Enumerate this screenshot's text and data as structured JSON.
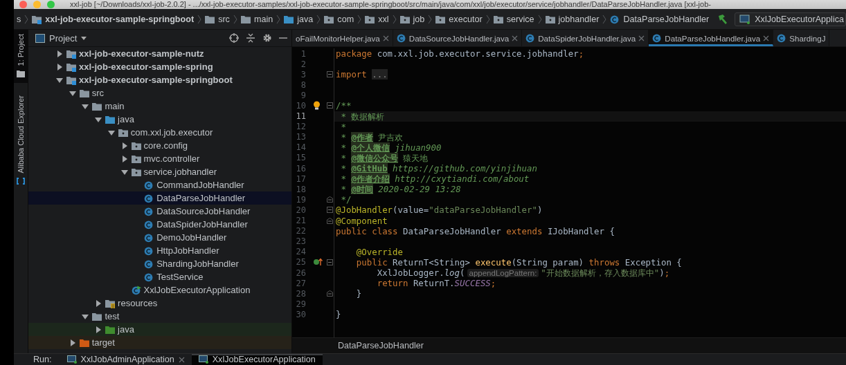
{
  "window": {
    "title": "xxl-job [~/Downloads/xxl-job-2.0.2] - .../xxl-job-executor-samples/xxl-job-executor-sample-springboot/src/main/java/com/xxl/job/executor/service/jobhandler/DataParseJobHandler.java [xxl-job-"
  },
  "navigation_bar": {
    "items": [
      {
        "label": "s",
        "kind": "plain"
      },
      {
        "label": "xxl-job-executor-sample-springboot",
        "kind": "module"
      },
      {
        "label": "src",
        "kind": "folder"
      },
      {
        "label": "main",
        "kind": "folder"
      },
      {
        "label": "java",
        "kind": "source"
      },
      {
        "label": "com",
        "kind": "package"
      },
      {
        "label": "xxl",
        "kind": "package"
      },
      {
        "label": "job",
        "kind": "package"
      },
      {
        "label": "executor",
        "kind": "package"
      },
      {
        "label": "service",
        "kind": "package"
      },
      {
        "label": "jobhandler",
        "kind": "package"
      },
      {
        "label": "DataParseJobHandler",
        "kind": "class"
      }
    ],
    "run_config": "XxlJobExecutorApplica"
  },
  "tool_stripe": [
    {
      "label": "1: Project",
      "selected": true
    },
    {
      "label": "Alibaba Cloud Explorer",
      "selected": false
    }
  ],
  "project_panel": {
    "title": "Project",
    "tree": [
      {
        "label": "xxl-job-executor-sample-nutz",
        "kind": "module",
        "expanded": false,
        "selected": false
      },
      {
        "label": "xxl-job-executor-sample-spring",
        "kind": "module",
        "expanded": false,
        "selected": false
      },
      {
        "label": "xxl-job-executor-sample-springboot",
        "kind": "module",
        "expanded": true,
        "selected": false,
        "children": [
          {
            "label": "src",
            "kind": "folder",
            "expanded": true,
            "selected": false,
            "children": [
              {
                "label": "main",
                "kind": "folder",
                "expanded": true,
                "selected": false,
                "children": [
                  {
                    "label": "java",
                    "kind": "source",
                    "expanded": true,
                    "selected": false,
                    "children": [
                      {
                        "label": "com.xxl.job.executor",
                        "kind": "package",
                        "expanded": true,
                        "selected": false,
                        "children": [
                          {
                            "label": "core.config",
                            "kind": "package",
                            "expanded": false,
                            "selected": false
                          },
                          {
                            "label": "mvc.controller",
                            "kind": "package",
                            "expanded": false,
                            "selected": false
                          },
                          {
                            "label": "service.jobhandler",
                            "kind": "package",
                            "expanded": true,
                            "selected": false,
                            "children": [
                              {
                                "label": "CommandJobHandler",
                                "kind": "class",
                                "selected": false
                              },
                              {
                                "label": "DataParseJobHandler",
                                "kind": "class",
                                "selected": true
                              },
                              {
                                "label": "DataSourceJobHandler",
                                "kind": "class",
                                "selected": false
                              },
                              {
                                "label": "DataSpiderJobHandler",
                                "kind": "class",
                                "selected": false
                              },
                              {
                                "label": "DemoJobHandler",
                                "kind": "class",
                                "selected": false
                              },
                              {
                                "label": "HttpJobHandler",
                                "kind": "class",
                                "selected": false
                              },
                              {
                                "label": "ShardingJobHandler",
                                "kind": "class",
                                "selected": false
                              },
                              {
                                "label": "TestService",
                                "kind": "class",
                                "selected": false
                              }
                            ]
                          },
                          {
                            "label": "XxlJobExecutorApplication",
                            "kind": "application",
                            "selected": false
                          }
                        ]
                      }
                    ]
                  },
                  {
                    "label": "resources",
                    "kind": "resources",
                    "expanded": false,
                    "selected": false
                  }
                ]
              },
              {
                "label": "test",
                "kind": "folder",
                "expanded": true,
                "selected": false,
                "children": [
                  {
                    "label": "java",
                    "kind": "test",
                    "expanded": false,
                    "selected": false
                  }
                ]
              }
            ]
          },
          {
            "label": "target",
            "kind": "excluded",
            "expanded": false,
            "selected": false
          }
        ]
      }
    ]
  },
  "editor": {
    "tabs": [
      {
        "label": "oFailMonitorHelper.java",
        "kind": "plain",
        "selected": false
      },
      {
        "label": "DataSourceJobHandler.java",
        "kind": "class",
        "selected": false
      },
      {
        "label": "DataSpiderJobHandler.java",
        "kind": "class",
        "selected": false
      },
      {
        "label": "DataParseJobHandler.java",
        "kind": "class",
        "selected": true
      },
      {
        "label": "ShardingJ",
        "kind": "class",
        "selected": false
      }
    ],
    "lines": [
      {
        "number": "1",
        "current": false,
        "kind": "plain",
        "tokens": [
          {
            "kind": "keyword",
            "t": "package "
          },
          {
            "kind": "plain",
            "t": "com.xxl.job.executor.service.jobhandler"
          },
          {
            "kind": "keyword",
            "t": ";"
          }
        ]
      },
      {
        "number": "2",
        "current": false,
        "kind": "plain"
      },
      {
        "number": "3",
        "current": false,
        "kind": "fold",
        "tokens": [
          {
            "kind": "keyword",
            "t": "import "
          },
          {
            "kind": "folded",
            "t": "..."
          }
        ]
      },
      {
        "number": "8",
        "current": false,
        "kind": "plain"
      },
      {
        "number": "9",
        "current": false,
        "kind": "plain"
      },
      {
        "number": "10",
        "current": false,
        "kind": "hint",
        "tokens": [
          {
            "kind": "doc",
            "t": "/**"
          }
        ]
      },
      {
        "number": "11",
        "current": true,
        "kind": "plain",
        "tokens": [
          {
            "kind": "doc",
            "t": " * 数据解析"
          }
        ]
      },
      {
        "number": "12",
        "current": false,
        "kind": "plain",
        "tokens": [
          {
            "kind": "doc",
            "t": " *"
          }
        ]
      },
      {
        "number": "13",
        "current": false,
        "kind": "plain",
        "tokens": [
          {
            "kind": "doc",
            "t": " * "
          },
          {
            "kind": "doctag",
            "t": "@作者"
          },
          {
            "kind": "doc",
            "t": " 尹吉欢"
          }
        ]
      },
      {
        "number": "14",
        "current": false,
        "kind": "plain",
        "tokens": [
          {
            "kind": "doc",
            "t": " * "
          },
          {
            "kind": "doctag",
            "t": "@个人微信"
          },
          {
            "kind": "docvalue",
            "t": " jihuan900"
          }
        ]
      },
      {
        "number": "15",
        "current": false,
        "kind": "plain",
        "tokens": [
          {
            "kind": "doc",
            "t": " * "
          },
          {
            "kind": "doctag",
            "t": "@微信公众号"
          },
          {
            "kind": "doc",
            "t": " 猿天地"
          }
        ]
      },
      {
        "number": "16",
        "current": false,
        "kind": "plain",
        "tokens": [
          {
            "kind": "doc",
            "t": " * "
          },
          {
            "kind": "doctag",
            "t": "@GitHub"
          },
          {
            "kind": "docvalue",
            "t": " https://github.com/yinjihuan"
          }
        ]
      },
      {
        "number": "17",
        "current": false,
        "kind": "plain",
        "tokens": [
          {
            "kind": "doc",
            "t": " * "
          },
          {
            "kind": "doctag",
            "t": "@作者介绍"
          },
          {
            "kind": "docvalue",
            "t": " http://cxytiandi.com/about"
          }
        ]
      },
      {
        "number": "18",
        "current": false,
        "kind": "plain",
        "tokens": [
          {
            "kind": "doc",
            "t": " * "
          },
          {
            "kind": "doctag",
            "t": "@时间"
          },
          {
            "kind": "docvalue",
            "t": " 2020-02-29 13:28"
          }
        ]
      },
      {
        "number": "19",
        "current": false,
        "kind": "foldend",
        "tokens": [
          {
            "kind": "doc",
            "t": " */"
          }
        ]
      },
      {
        "number": "20",
        "current": false,
        "kind": "fold",
        "tokens": [
          {
            "kind": "annotation",
            "t": "@JobHandler"
          },
          {
            "kind": "plain",
            "t": "(value="
          },
          {
            "kind": "string",
            "t": "\"dataParseJobHandler\""
          },
          {
            "kind": "plain",
            "t": ")"
          }
        ]
      },
      {
        "number": "21",
        "current": false,
        "kind": "foldend",
        "tokens": [
          {
            "kind": "annotation",
            "t": "@Component"
          }
        ]
      },
      {
        "number": "22",
        "current": false,
        "kind": "plain",
        "tokens": [
          {
            "kind": "keyword",
            "t": "public class "
          },
          {
            "kind": "plain",
            "t": "DataParseJobHandler "
          },
          {
            "kind": "keyword",
            "t": "extends "
          },
          {
            "kind": "plain",
            "t": "IJobHandler {"
          }
        ]
      },
      {
        "number": "23",
        "current": false,
        "kind": "plain"
      },
      {
        "number": "24",
        "current": false,
        "kind": "plain",
        "tokens": [
          {
            "kind": "annotation",
            "t": "    @Override"
          }
        ]
      },
      {
        "number": "25",
        "current": false,
        "kind": "override",
        "tokens": [
          {
            "kind": "keyword",
            "t": "    public "
          },
          {
            "kind": "plain",
            "t": "ReturnT<String> "
          },
          {
            "kind": "method",
            "t": "execute"
          },
          {
            "kind": "plain",
            "t": "(String param) "
          },
          {
            "kind": "keyword",
            "t": "throws "
          },
          {
            "kind": "plain",
            "t": "Exception {"
          }
        ]
      },
      {
        "number": "26",
        "current": false,
        "kind": "plain",
        "tokens": [
          {
            "kind": "plain",
            "t": "        XxlJobLogger."
          },
          {
            "kind": "static",
            "t": "log"
          },
          {
            "kind": "plain",
            "t": "("
          },
          {
            "kind": "parameter",
            "t": "appendLogPattern:"
          },
          {
            "kind": "string",
            "t": "\"开始数据解析，存入数据库中\""
          },
          {
            "kind": "plain",
            "t": ")"
          },
          {
            "kind": "keyword",
            "t": ";"
          }
        ]
      },
      {
        "number": "27",
        "current": false,
        "kind": "plain",
        "tokens": [
          {
            "kind": "keyword",
            "t": "        return "
          },
          {
            "kind": "plain",
            "t": "ReturnT."
          },
          {
            "kind": "constant",
            "t": "SUCCESS"
          },
          {
            "kind": "keyword",
            "t": ";"
          }
        ]
      },
      {
        "number": "28",
        "current": false,
        "kind": "foldend",
        "tokens": [
          {
            "kind": "plain",
            "t": "    }"
          }
        ]
      },
      {
        "number": "29",
        "current": false,
        "kind": "plain"
      },
      {
        "number": "30",
        "current": false,
        "kind": "plain",
        "tokens": [
          {
            "kind": "plain",
            "t": "}"
          }
        ]
      }
    ],
    "breadcrumb": "DataParseJobHandler"
  },
  "run_bar": {
    "label": "Run:",
    "tabs": [
      {
        "label": "XxlJobAdminApplication",
        "selected": false
      },
      {
        "label": "XxlJobExecutorApplication",
        "selected": true
      }
    ]
  }
}
